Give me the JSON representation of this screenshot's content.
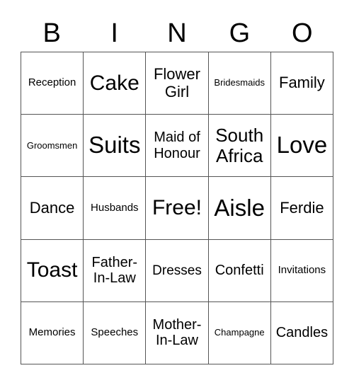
{
  "header": {
    "letters": [
      "B",
      "I",
      "N",
      "G",
      "O"
    ]
  },
  "card": {
    "rows": [
      [
        "Reception",
        "Cake",
        "Flower Girl",
        "Bridesmaids",
        "Family"
      ],
      [
        "Groomsmen",
        "Suits",
        "Maid of Honour",
        "South Africa",
        "Love"
      ],
      [
        "Dance",
        "Husbands",
        "Free!",
        "Aisle",
        "Ferdie"
      ],
      [
        "Toast",
        "Father-In-Law",
        "Dresses",
        "Confetti",
        "Invitations"
      ],
      [
        "Memories",
        "Speeches",
        "Mother-In-Law",
        "Champagne",
        "Candles"
      ]
    ]
  }
}
